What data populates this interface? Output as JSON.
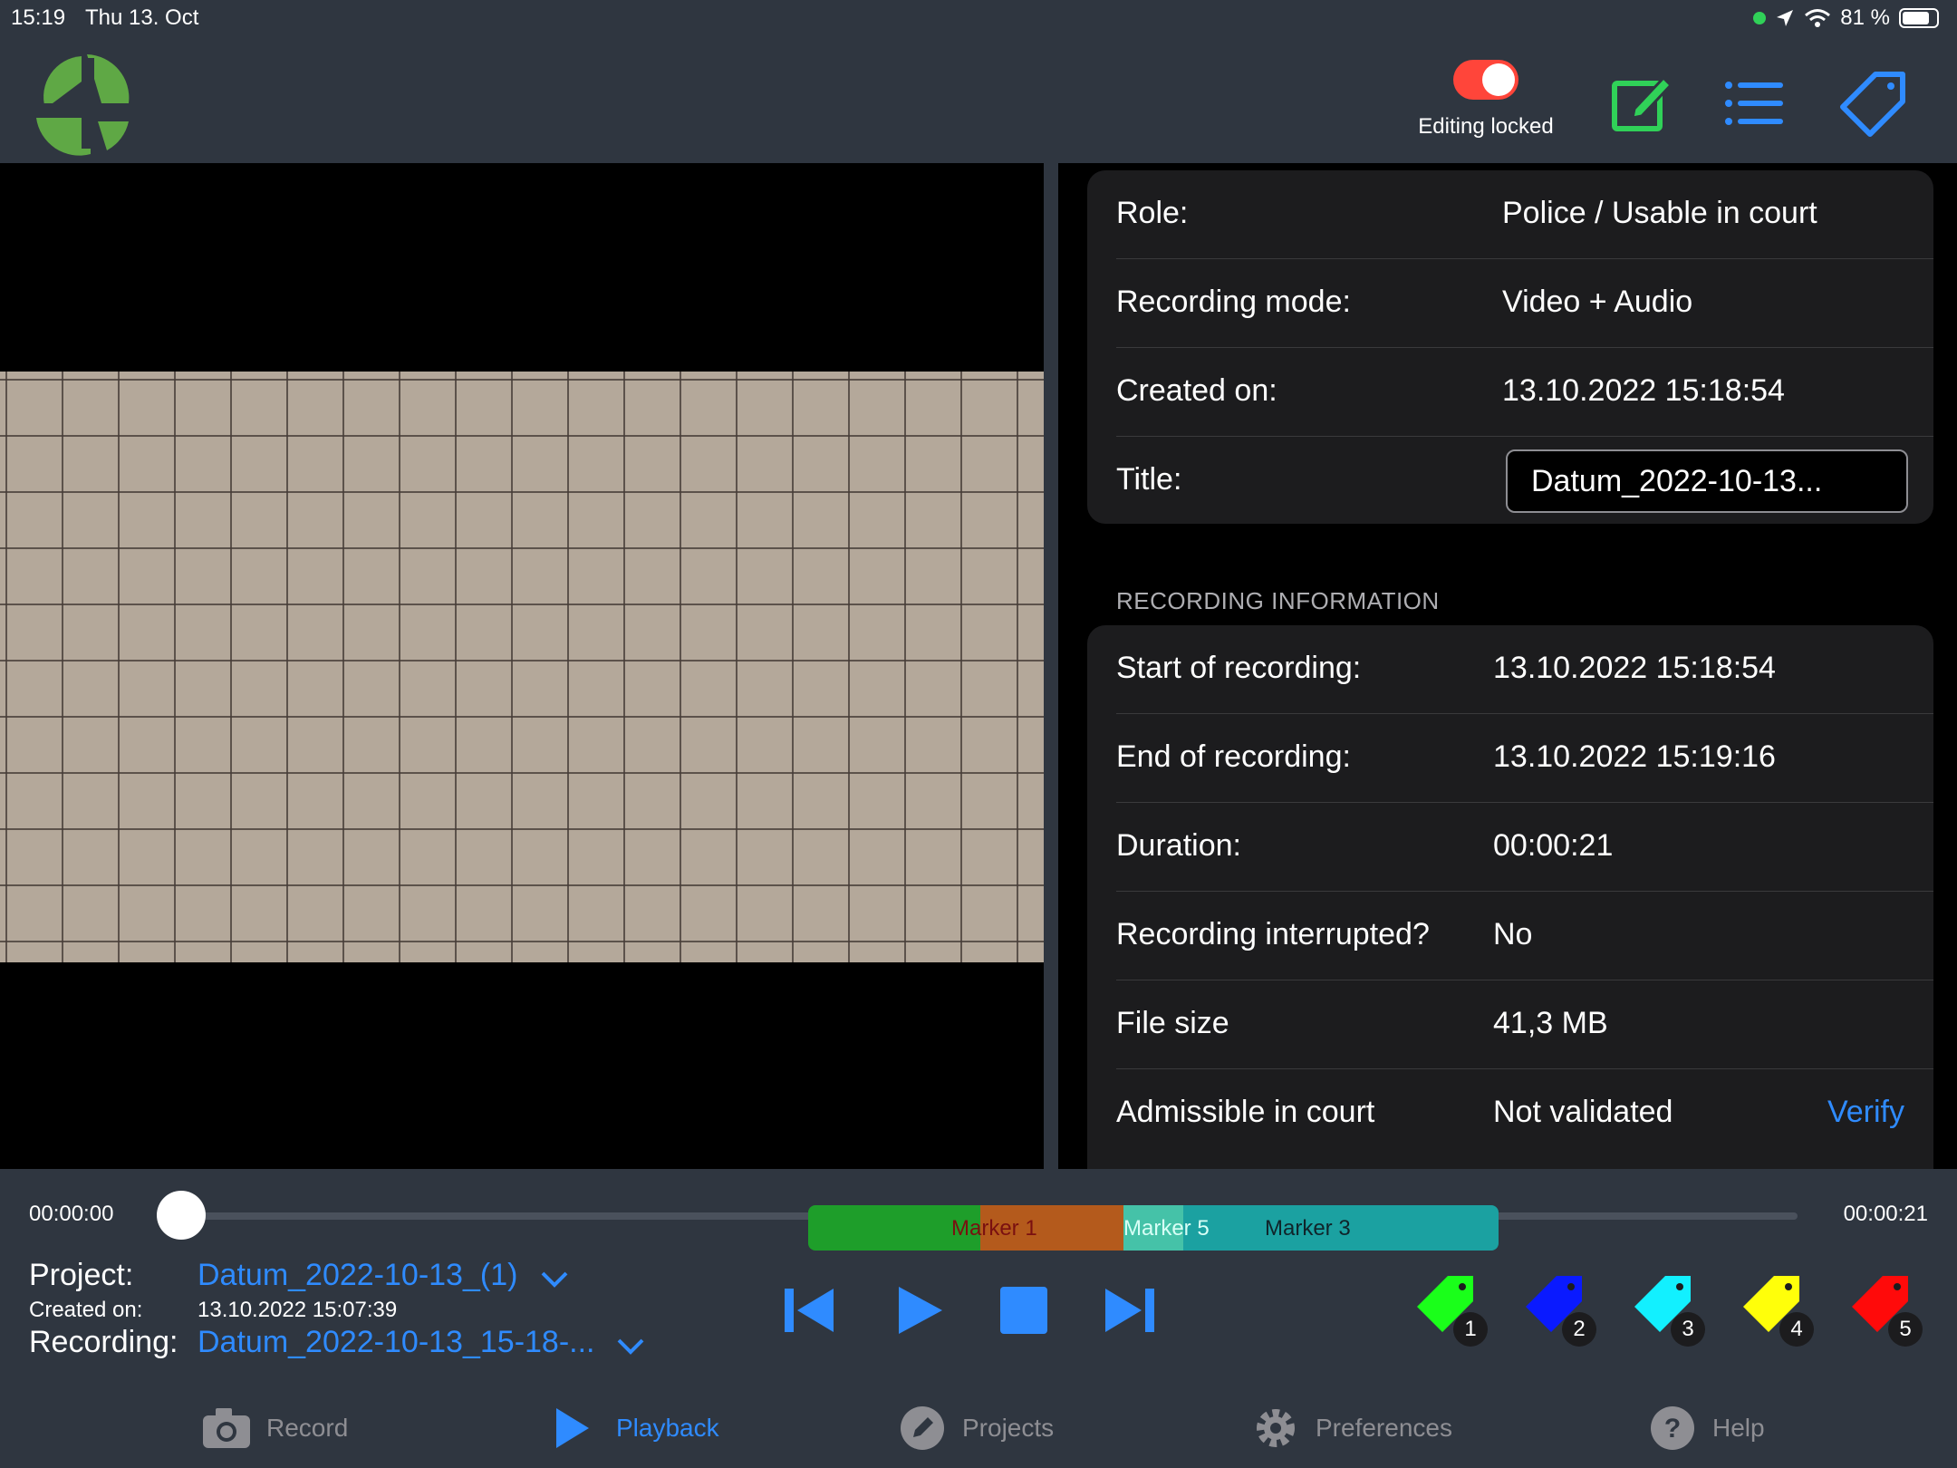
{
  "status_bar": {
    "time": "15:19",
    "date": "Thu 13. Oct",
    "battery": "81 %",
    "battery_level": 0.81
  },
  "header": {
    "lock_toggle_on": true,
    "lock_label": "Editing locked",
    "colors": {
      "toggle_on": "#ff453a",
      "edit_icon": "#30d158",
      "accent": "#2f8bff",
      "logo_green": "#5fa845"
    }
  },
  "details": {
    "rows": [
      {
        "label": "Role:",
        "value": "Police / Usable in court"
      },
      {
        "label": "Recording mode:",
        "value": "Video + Audio"
      },
      {
        "label": "Created on:",
        "value": "13.10.2022 15:18:54"
      }
    ],
    "title_label": "Title:",
    "title_value": "Datum_2022-10-13..."
  },
  "recording_info": {
    "section_title": "RECORDING INFORMATION",
    "rows": [
      {
        "label": "Start of recording:",
        "value": "13.10.2022 15:18:54"
      },
      {
        "label": "End of recording:",
        "value": "13.10.2022 15:19:16"
      },
      {
        "label": "Duration:",
        "value": "00:00:21"
      },
      {
        "label": "Recording interrupted?",
        "value": "No"
      },
      {
        "label": "File size",
        "value": "41,3 MB"
      },
      {
        "label": "Admissible in court",
        "value": "Not validated"
      }
    ],
    "verify_label": "Verify"
  },
  "playback": {
    "current_time": "00:00:00",
    "total_time": "00:00:21",
    "position_fraction": 0.0,
    "markers": [
      {
        "label": "Marker 1",
        "color": "#1e9e2a"
      },
      {
        "label": "Marker 5",
        "color": "#b45a1c"
      },
      {
        "label": "Marker 3",
        "color": "#1ba1a1"
      }
    ]
  },
  "project": {
    "project_label": "Project:",
    "project_value": "Datum_2022-10-13_(1)",
    "created_label": "Created on:",
    "created_value": "13.10.2022 15:07:39",
    "recording_label": "Recording:",
    "recording_value": "Datum_2022-10-13_15-18-..."
  },
  "marker_tags": [
    {
      "number": "1",
      "color": "#1aff1a"
    },
    {
      "number": "2",
      "color": "#0a1aff"
    },
    {
      "number": "3",
      "color": "#12f0ff"
    },
    {
      "number": "4",
      "color": "#ffff0a"
    },
    {
      "number": "5",
      "color": "#ff0a0a"
    }
  ],
  "tabs": [
    {
      "label": "Record",
      "icon": "camera-icon",
      "active": false
    },
    {
      "label": "Playback",
      "icon": "play-icon",
      "active": true
    },
    {
      "label": "Projects",
      "icon": "pencil-icon",
      "active": false
    },
    {
      "label": "Preferences",
      "icon": "gear-icon",
      "active": false
    },
    {
      "label": "Help",
      "icon": "help-icon",
      "active": false
    }
  ]
}
